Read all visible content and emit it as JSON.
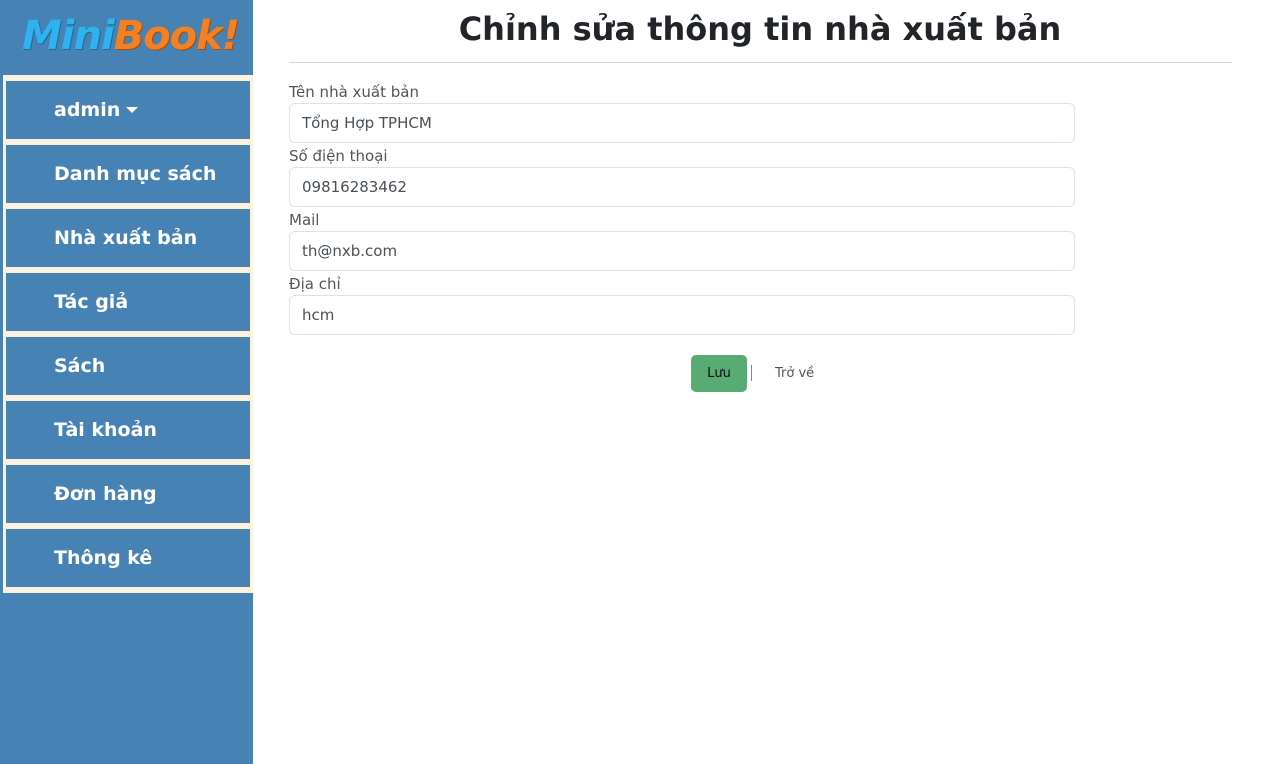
{
  "sidebar": {
    "logo": {
      "part1": "Mini",
      "part2": "Book!"
    },
    "items": [
      {
        "label": "admin",
        "has_dropdown": true
      },
      {
        "label": "Danh mục sách"
      },
      {
        "label": "Nhà xuất bản"
      },
      {
        "label": "Tác giả"
      },
      {
        "label": "Sách"
      },
      {
        "label": "Tài khoản"
      },
      {
        "label": "Đơn hàng"
      },
      {
        "label": "Thông kê"
      }
    ]
  },
  "main": {
    "title": "Chỉnh sửa thông tin nhà xuất bản",
    "form": {
      "fields": [
        {
          "label": "Tên nhà xuất bản",
          "value": "Tổng Hợp TPHCM"
        },
        {
          "label": "Số điện thoại",
          "value": "09816283462"
        },
        {
          "label": "Mail",
          "value": "th@nxb.com"
        },
        {
          "label": "Địa chỉ",
          "value": "hcm"
        }
      ],
      "save_label": "Lưu",
      "back_label": "Trở về"
    }
  },
  "colors": {
    "sidebar": "#4682b4",
    "nav_border": "#fdf0dc",
    "save_button": "#57ab73",
    "logo_mini": "#2fb3f0",
    "logo_book": "#f48024"
  }
}
